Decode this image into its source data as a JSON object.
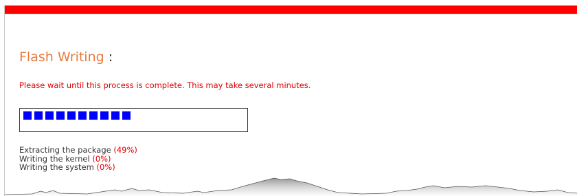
{
  "title": {
    "text": "Flash Writing",
    "colon": ":"
  },
  "notice": "Please wait until this process is complete. This may take several minutes.",
  "progress": {
    "blocks_filled": 10,
    "fill_color": "#0000ff",
    "border_color": "#3a3a3a"
  },
  "steps": [
    {
      "label": "Extracting the package",
      "percent": "(49%)"
    },
    {
      "label": "Writing the kernel",
      "percent": "(0%)"
    },
    {
      "label": "Writing the system",
      "percent": "(0%)"
    }
  ],
  "colors": {
    "top_bar": "#ff0000",
    "title": "#e87a3c",
    "notice": "#e00000",
    "percent": "#e00000"
  }
}
